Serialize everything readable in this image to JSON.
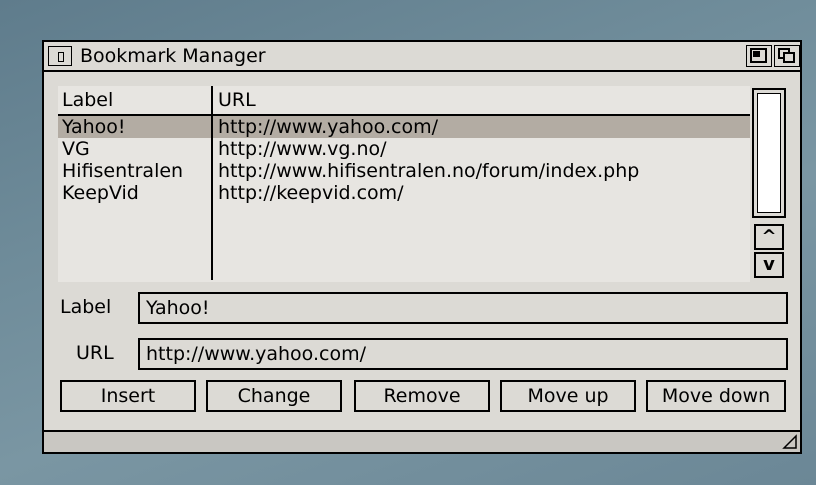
{
  "window": {
    "title": "Bookmark Manager"
  },
  "list": {
    "headers": {
      "label": "Label",
      "url": "URL"
    },
    "rows": [
      {
        "label": "Yahoo!",
        "url": "http://www.yahoo.com/",
        "selected": true
      },
      {
        "label": "VG",
        "url": "http://www.vg.no/",
        "selected": false
      },
      {
        "label": "Hifisentralen",
        "url": "http://www.hifisentralen.no/forum/index.php",
        "selected": false
      },
      {
        "label": "KeepVid",
        "url": "http://keepvid.com/",
        "selected": false
      }
    ],
    "scroll_up_glyph": "^",
    "scroll_down_glyph": "v"
  },
  "form": {
    "label_caption": "Label",
    "label_value": "Yahoo!",
    "url_caption": "URL",
    "url_value": "http://www.yahoo.com/"
  },
  "buttons": {
    "insert": "Insert",
    "change": "Change",
    "remove": "Remove",
    "move_up": "Move up",
    "move_down": "Move down"
  },
  "colors": {
    "selection": "#b3aca3",
    "window_bg": "#dcdad5",
    "desktop": "#6f8c9a"
  }
}
